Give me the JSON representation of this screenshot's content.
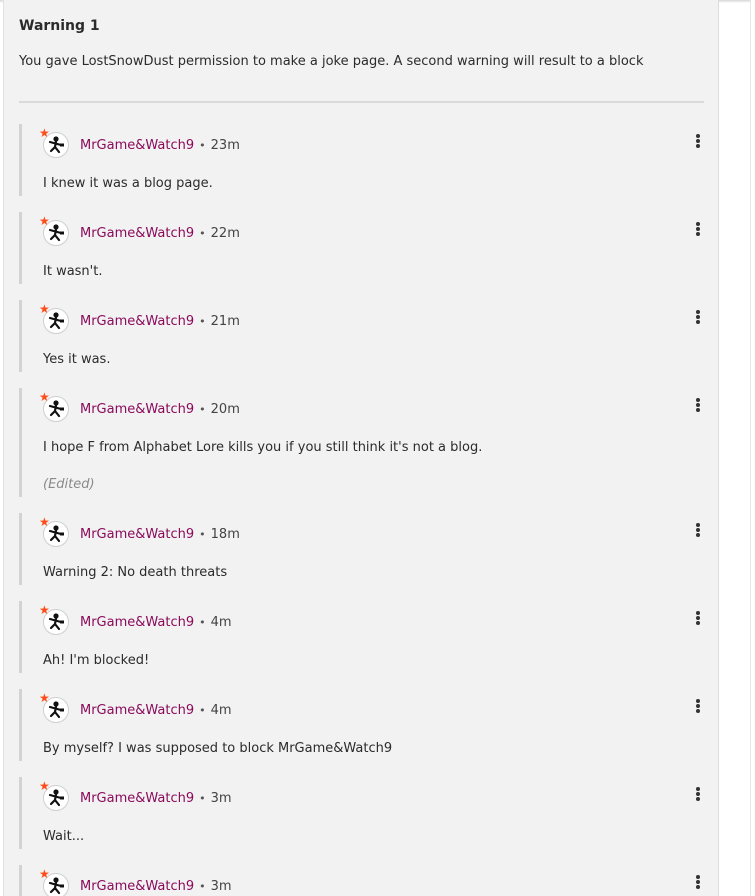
{
  "post": {
    "title": "Warning 1",
    "body": "You gave LostSnowDust permission to make a joke page. A second warning will result to a block"
  },
  "colors": {
    "author": "#8a0b5a",
    "panel": "#f2f2f2",
    "thread_line": "#d3d3d3"
  },
  "replies": [
    {
      "author": "MrGame&Watch9",
      "separator": "•",
      "time": "23m",
      "text": "I knew it was a blog page.",
      "edited": ""
    },
    {
      "author": "MrGame&Watch9",
      "separator": "•",
      "time": "22m",
      "text": "It wasn't.",
      "edited": ""
    },
    {
      "author": "MrGame&Watch9",
      "separator": "•",
      "time": "21m",
      "text": "Yes it was.",
      "edited": ""
    },
    {
      "author": "MrGame&Watch9",
      "separator": "•",
      "time": "20m",
      "text": "I hope F from Alphabet Lore kills you if you still think it's not a blog.",
      "edited": "(Edited)"
    },
    {
      "author": "MrGame&Watch9",
      "separator": "•",
      "time": "18m",
      "text": "Warning 2: No death threats",
      "edited": ""
    },
    {
      "author": "MrGame&Watch9",
      "separator": "•",
      "time": "4m",
      "text": "Ah! I'm blocked!",
      "edited": ""
    },
    {
      "author": "MrGame&Watch9",
      "separator": "•",
      "time": "4m",
      "text": "By myself? I was supposed to block MrGame&Watch9",
      "edited": ""
    },
    {
      "author": "MrGame&Watch9",
      "separator": "•",
      "time": "3m",
      "text": "Wait...",
      "edited": ""
    },
    {
      "author": "MrGame&Watch9",
      "separator": "•",
      "time": "3m",
      "text": "",
      "edited": ""
    }
  ],
  "icons": {
    "avatar": "game-and-watch-avatar-icon",
    "badge": "star-badge-icon",
    "menu": "kebab-menu-icon"
  }
}
